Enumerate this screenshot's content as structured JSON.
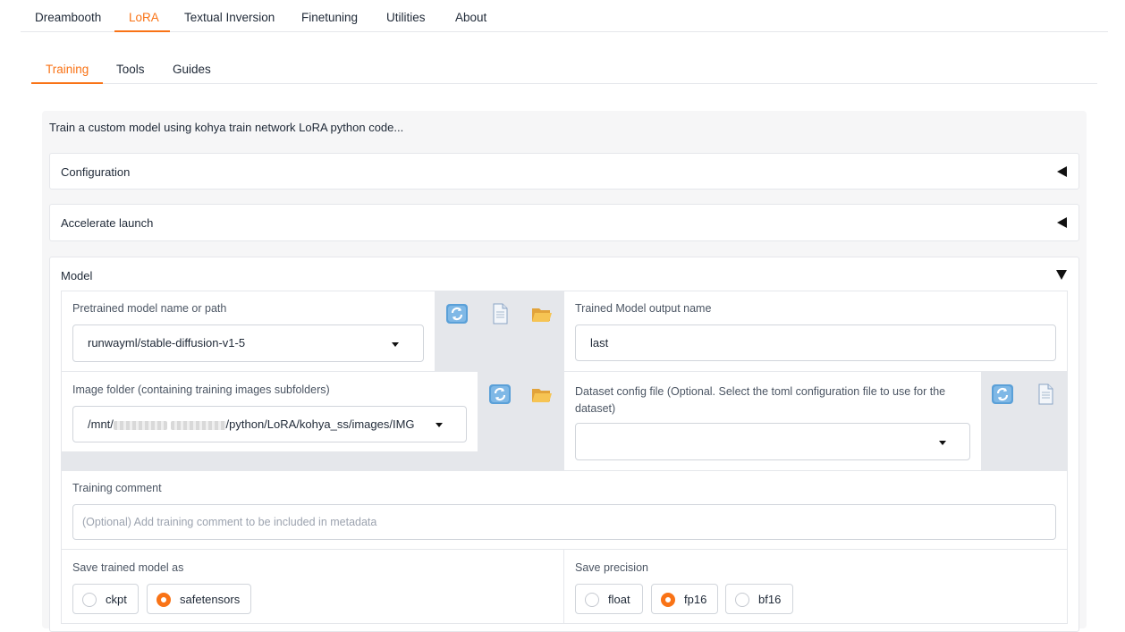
{
  "top_tabs": [
    "Dreambooth",
    "LoRA",
    "Textual Inversion",
    "Finetuning",
    "Utilities",
    "About"
  ],
  "sub_tabs": [
    "Training",
    "Tools",
    "Guides"
  ],
  "description": "Train a custom model using kohya train network LoRA python code...",
  "accordions": {
    "configuration": "Configuration",
    "accelerate": "Accelerate launch",
    "model": "Model"
  },
  "model": {
    "pretrained_label": "Pretrained model name or path",
    "pretrained_value": "runwayml/stable-diffusion-v1-5",
    "output_name_label": "Trained Model output name",
    "output_name_value": "last",
    "image_folder_label": "Image folder (containing training images subfolders)",
    "image_folder_prefix": "/mnt/",
    "image_folder_suffix": "/python/LoRA/kohya_ss/images/IMG",
    "dataset_config_label": "Dataset config file (Optional. Select the toml configuration file to use for the dataset)",
    "dataset_config_value": "",
    "comment_label": "Training comment",
    "comment_placeholder": "(Optional) Add training comment to be included in metadata",
    "save_as_label": "Save trained model as",
    "save_as_options": [
      "ckpt",
      "safetensors"
    ],
    "save_as_selected": "safetensors",
    "precision_label": "Save precision",
    "precision_options": [
      "float",
      "fp16",
      "bf16"
    ],
    "precision_selected": "fp16"
  },
  "icons": {
    "refresh": "refresh-icon",
    "document": "document-icon",
    "folder": "folder-icon"
  },
  "colors": {
    "accent": "#f97316",
    "panel": "#f6f6f7",
    "group_gray": "#e5e7eb"
  }
}
